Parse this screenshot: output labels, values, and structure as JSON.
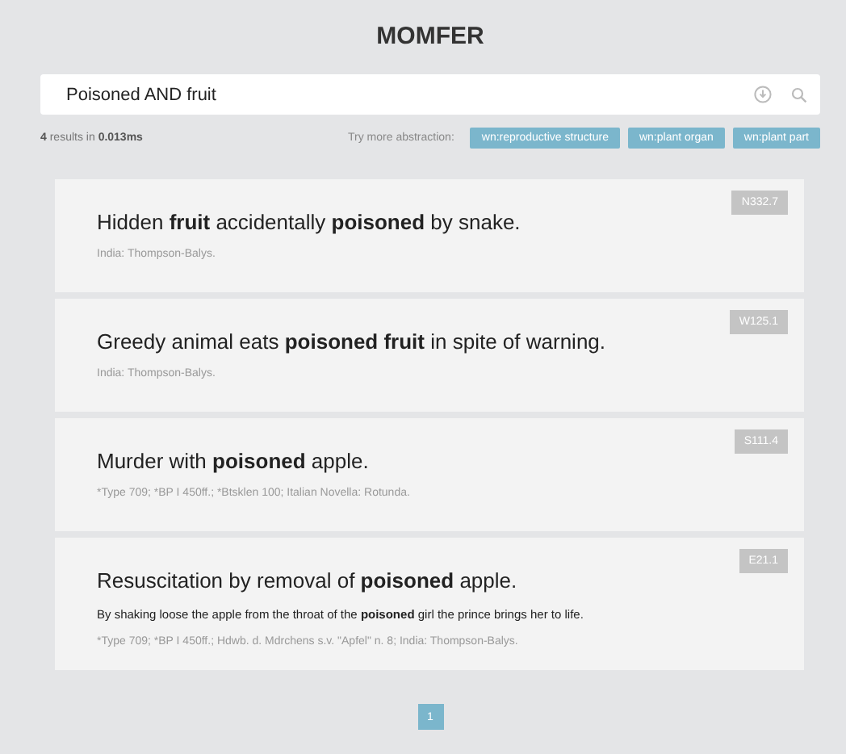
{
  "header": {
    "title": "MOMFER"
  },
  "search": {
    "value": "Poisoned AND fruit"
  },
  "results_summary": "**4** results in **0.013ms**",
  "abstraction": {
    "label": "Try more abstraction:",
    "tags": [
      "wn:reproductive structure",
      "wn:plant organ",
      "wn:plant part"
    ]
  },
  "results": [
    {
      "title": "Hidden **fruit** accidentally **poisoned** by snake.",
      "code": "N332.7",
      "sources": "India: Thompson-Balys."
    },
    {
      "title": "Greedy animal eats **poisoned fruit** in spite of warning.",
      "code": "W125.1",
      "sources": "India: Thompson-Balys."
    },
    {
      "title": "Murder with **poisoned** apple.",
      "code": "S111.4",
      "sources": "*Type 709; *BP I 450ff.; *Btsklen 100; Italian Novella: Rotunda."
    },
    {
      "title": "Resuscitation by removal of **poisoned** apple.",
      "code": "E21.1",
      "description": "By shaking loose the apple from the throat of the **poisoned** girl the prince brings her to life.",
      "sources": "*Type 709; *BP I 450ff.; Hdwb. d. Mdrchens s.v. \"Apfel\" n. 8; India: Thompson-Balys."
    }
  ],
  "pagination": [
    {
      "label": "1",
      "selected": true
    }
  ]
}
